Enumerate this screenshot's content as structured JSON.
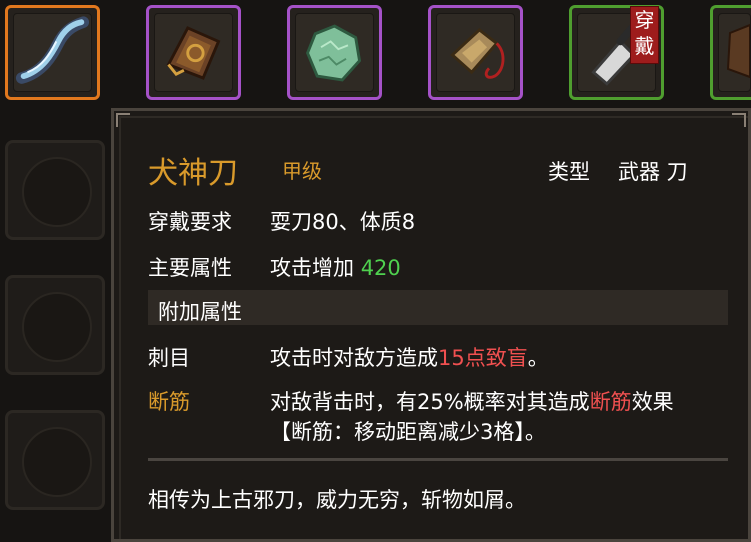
{
  "equipment_slots": [
    {
      "name": "curved-blade-slot",
      "rarity": "orange",
      "icon": "curved-blade-icon"
    },
    {
      "name": "leather-armor-slot",
      "rarity": "purple",
      "icon": "leather-armor-icon"
    },
    {
      "name": "jade-stone-slot",
      "rarity": "purple",
      "icon": "jade-stone-icon"
    },
    {
      "name": "amulet-slot",
      "rarity": "purple",
      "icon": "amulet-icon"
    },
    {
      "name": "cleaver-slot",
      "rarity": "green",
      "icon": "cleaver-icon",
      "badge": "穿戴"
    },
    {
      "name": "partial-slot",
      "rarity": "green",
      "icon": "partial-item-icon"
    }
  ],
  "colors": {
    "orange": "#e1781e",
    "purple": "#a552c8",
    "green": "#4f9e2f",
    "title": "#d99a2b",
    "value_green": "#4fd14f",
    "red": "#f05050"
  },
  "tooltip": {
    "name": "犬神刀",
    "grade": "甲级",
    "type_label": "类型",
    "type_value": "武器 刀",
    "requirement_label": "穿戴要求",
    "requirement_value": "耍刀80、体质8",
    "main_attr_label": "主要属性",
    "main_attr_text": "攻击增加",
    "main_attr_value": "420",
    "extra_header": "附加属性",
    "effects": [
      {
        "name": "刺目",
        "parts": [
          "攻击时对敌方造成",
          "15点致盲",
          "。"
        ]
      },
      {
        "name": "断筋",
        "parts": [
          "对敌背击时，有25%概率对其造成",
          "断筋",
          "效果"
        ],
        "line2": "【断筋：移动距离减少3格】。"
      }
    ],
    "description": "相传为上古邪刀，威力无穷，斩物如屑。"
  }
}
